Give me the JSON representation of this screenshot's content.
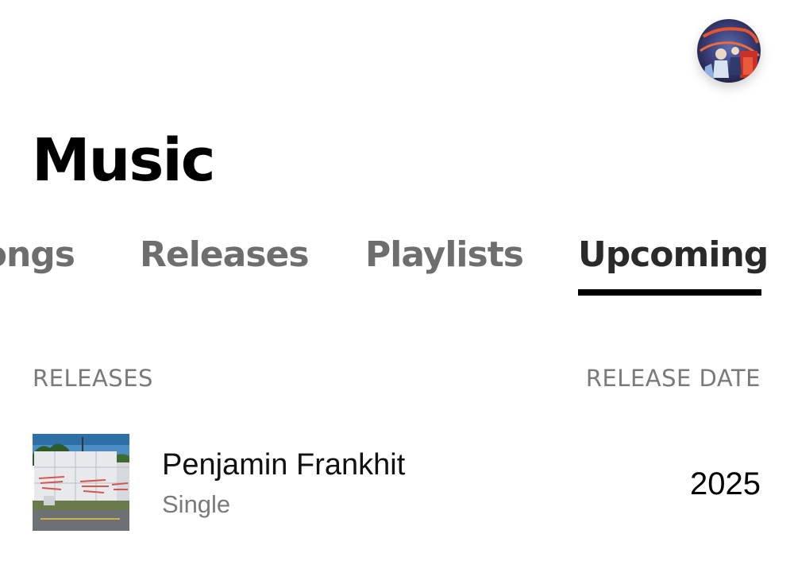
{
  "header": {
    "avatar_icon": "user-avatar-photo"
  },
  "page": {
    "title": "Music"
  },
  "tabs": [
    {
      "label": "ongs",
      "active": false
    },
    {
      "label": "Releases",
      "active": false
    },
    {
      "label": "Playlists",
      "active": false
    },
    {
      "label": "Upcoming",
      "active": true
    }
  ],
  "list": {
    "column_releases": "RELEASES",
    "column_release_date": "RELEASE DATE",
    "items": [
      {
        "title": "Penjamin Frankhit",
        "type": "Single",
        "release_date": "2025",
        "artwork_icon": "album-artwork"
      }
    ]
  },
  "colors": {
    "text_primary": "#000000",
    "text_secondary": "#7a7a7a",
    "tab_inactive": "#6e6e6e",
    "tab_active": "#2a2a2a",
    "active_indicator": "#000000"
  }
}
